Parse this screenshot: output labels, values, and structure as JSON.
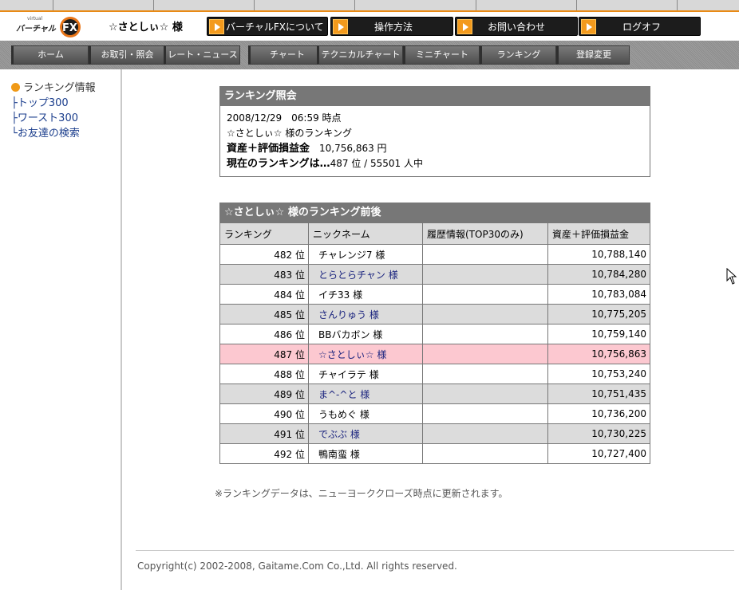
{
  "header": {
    "logo_top": "virtual",
    "logo_main": "バーチャル",
    "logo_fx": "FX",
    "user_name": "☆さとしぃ☆ 様",
    "buttons": [
      "バーチャルFXについて",
      "操作方法",
      "お問い合わせ",
      "ログオフ"
    ]
  },
  "nav": {
    "tabs": [
      "ホーム",
      "お取引・照会",
      "レート・ニュース",
      "チャート",
      "テクニカルチャート",
      "ミニチャート",
      "ランキング",
      "登録変更"
    ]
  },
  "sidebar": {
    "title": "ランキング情報",
    "links": [
      "├トップ300",
      "├ワースト300",
      "└お友達の検索"
    ]
  },
  "info": {
    "title": "ランキング照会",
    "datetime": "2008/12/29　06:59 時点",
    "owner": "☆さとしぃ☆ 様のランキング",
    "assets_label": "資産＋評価損益金",
    "assets_value": "10,756,863 円",
    "rank_label": "現在のランキングは…",
    "rank_value": "487 位 / 55501 人中"
  },
  "ranking": {
    "title": "☆さとしぃ☆ 様のランキング前後",
    "columns": [
      "ランキング",
      "ニックネーム",
      "履歴情報(TOP30のみ)",
      "資産＋評価損益金"
    ],
    "rows": [
      {
        "rank": "482 位",
        "nick": "チャレンジ7 様",
        "history": "",
        "assets": "10,788,140",
        "link": false,
        "style": ""
      },
      {
        "rank": "483 位",
        "nick": "とらとらチャン 様",
        "history": "",
        "assets": "10,784,280",
        "link": true,
        "style": "alt"
      },
      {
        "rank": "484 位",
        "nick": "イチ33 様",
        "history": "",
        "assets": "10,783,084",
        "link": false,
        "style": ""
      },
      {
        "rank": "485 位",
        "nick": "さんりゅう 様",
        "history": "",
        "assets": "10,775,205",
        "link": true,
        "style": "alt"
      },
      {
        "rank": "486 位",
        "nick": "BBバカボン 様",
        "history": "",
        "assets": "10,759,140",
        "link": false,
        "style": ""
      },
      {
        "rank": "487 位",
        "nick": "☆さとしぃ☆ 様",
        "history": "",
        "assets": "10,756,863",
        "link": true,
        "style": "self"
      },
      {
        "rank": "488 位",
        "nick": "チャイラテ 様",
        "history": "",
        "assets": "10,753,240",
        "link": false,
        "style": ""
      },
      {
        "rank": "489 位",
        "nick": "ま^-^と 様",
        "history": "",
        "assets": "10,751,435",
        "link": true,
        "style": "alt"
      },
      {
        "rank": "490 位",
        "nick": "うもめぐ 様",
        "history": "",
        "assets": "10,736,200",
        "link": false,
        "style": ""
      },
      {
        "rank": "491 位",
        "nick": "でぶぶ 様",
        "history": "",
        "assets": "10,730,225",
        "link": true,
        "style": "alt"
      },
      {
        "rank": "492 位",
        "nick": "鴨南蛮 様",
        "history": "",
        "assets": "10,727,400",
        "link": false,
        "style": ""
      }
    ]
  },
  "note": "※ランキングデータは、ニューヨーククローズ時点に更新されます。",
  "copyright": "Copyright(c) 2002-2008, Gaitame.Com Co.,Ltd. All rights reserved.",
  "colors": {
    "accent": "#f39a1d",
    "header_panel": "#777777",
    "self_row": "#fcc8d0",
    "link": "#1a237e"
  }
}
